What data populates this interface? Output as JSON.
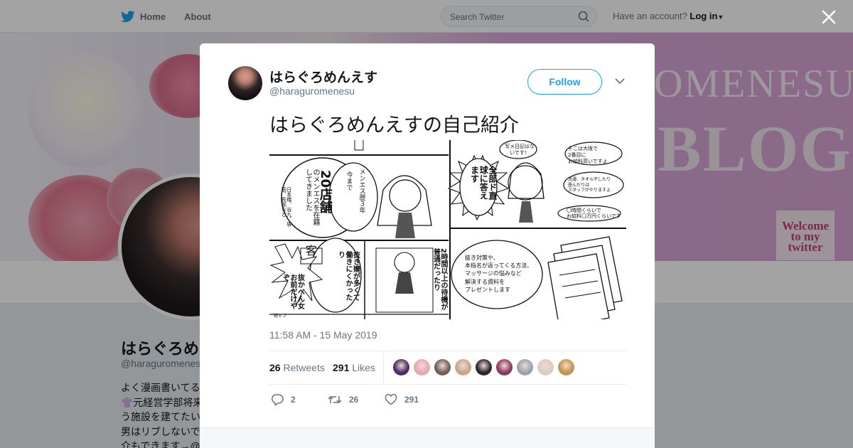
{
  "topbar": {
    "home_label": "Home",
    "about_label": "About",
    "search_placeholder": "Search Twitter",
    "have_account": "Have an account?",
    "login_label": "Log in"
  },
  "banner": {
    "title_text": "OMENESU",
    "blog_text": "BLOG",
    "welcome_line1": "Welcome",
    "welcome_line2": "to my",
    "welcome_line3": "twitter"
  },
  "profile": {
    "name": "はらぐろめ",
    "handle": "@haraguromenes",
    "bio": [
      "よく漫画書いてる",
      "👚元経営学部将来",
      "う施設を建てたい",
      "男はリブしないで",
      "介もできます→@"
    ]
  },
  "tweet": {
    "author_name": "はらぐろめんえす",
    "author_handle": "@haraguromenesu",
    "follow_label": "Follow",
    "text": "はらぐろめんえすの自己紹介",
    "timestamp": "11:58 AM - 15 May 2019",
    "retweets_count": "26",
    "retweets_label": "Retweets",
    "likes_count": "291",
    "likes_label": "Likes",
    "reply_count": "2",
    "retweet_action_count": "26",
    "like_action_count": "291",
    "liker_colors": [
      "#4a2a6a",
      "#e7a8b0",
      "#6d5f58",
      "#c9a58c",
      "#2b2630",
      "#8a3a62",
      "#9aa3ad",
      "#d9ccc4",
      "#c4944a"
    ]
  },
  "manga": {
    "p1_career": "メンエス歴３年",
    "p1_until": "今まで",
    "p1_stores": "20店舗",
    "p1_worked": "のメンエスを在籍してきました",
    "p1_places": "日本橋、谷九、堺筋、長堀など",
    "p2_answer": "全部ド直球に答えます",
    "p2_bubble1": "写メ日記はないです！",
    "p2_bubble2a": "そこは大阪で",
    "p2_bubble2b": "2番目に",
    "p2_bubble2c": "お給料高いですよ",
    "p2_bubble3a": "洗濯、タオル干したり",
    "p2_bubble3b": "畳んだりは",
    "p2_bubble3c": "スタッフがやりますよ",
    "p2_bubble4a": "〇時間くらいで",
    "p2_bubble4b": "お給料〇万円くらいです",
    "p3_customer": "客",
    "p3_quote": "抜かへん女お前だけやぞ",
    "p3_hard": "抜き嬢が多くて働きにくかったり",
    "p3_wait": "2時間以上の待機が普通だったり",
    "p3_corner": "続ミブ",
    "p4_line1": "抜き対策や、",
    "p4_line2": "本指名が返ってくる方法、",
    "p4_line3": "マッサージの悩みなど",
    "p4_line4": "解決する資料を",
    "p4_line5": "プレゼントします"
  }
}
